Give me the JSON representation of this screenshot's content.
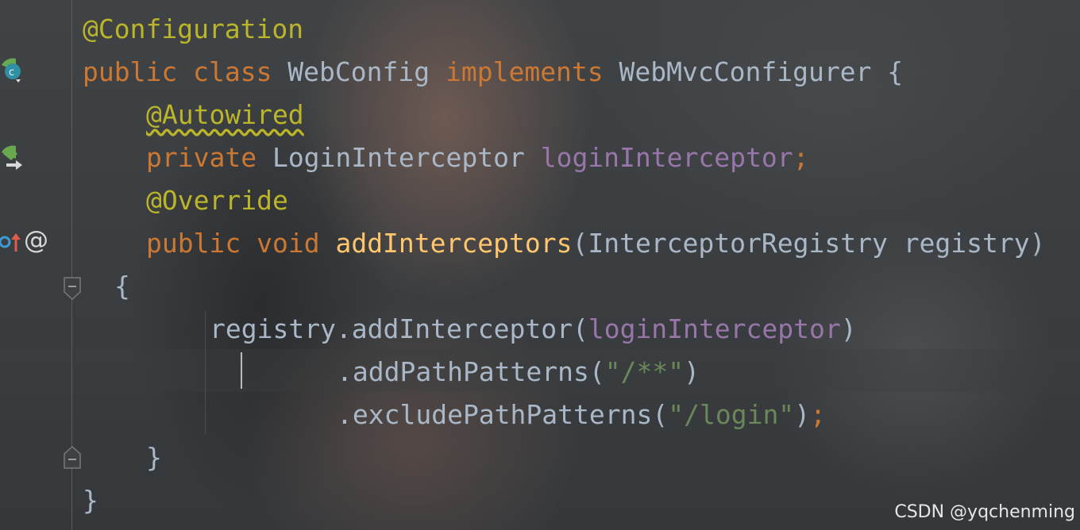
{
  "editor": {
    "lines": [
      {
        "tokens": [
          {
            "text": "@Configuration",
            "type": "ann"
          }
        ]
      },
      {
        "tokens": [
          {
            "text": "public",
            "type": "kw"
          },
          {
            "text": " ",
            "type": "plain"
          },
          {
            "text": "class",
            "type": "kw"
          },
          {
            "text": " WebConfig ",
            "type": "plain"
          },
          {
            "text": "implements",
            "type": "kw"
          },
          {
            "text": " WebMvcConfigurer {",
            "type": "plain"
          }
        ]
      },
      {
        "tokens": [
          {
            "text": "@Autowired",
            "type": "ann",
            "squiggle": true
          }
        ]
      },
      {
        "tokens": [
          {
            "text": "private",
            "type": "kw"
          },
          {
            "text": " LoginInterceptor ",
            "type": "plain"
          },
          {
            "text": "loginInterceptor",
            "type": "fld"
          },
          {
            "text": ";",
            "type": "kw"
          }
        ]
      },
      {
        "tokens": [
          {
            "text": "@Override",
            "type": "ann"
          }
        ]
      },
      {
        "tokens": [
          {
            "text": "public",
            "type": "kw"
          },
          {
            "text": " ",
            "type": "plain"
          },
          {
            "text": "void",
            "type": "kw"
          },
          {
            "text": " ",
            "type": "plain"
          },
          {
            "text": "addInterceptors",
            "type": "mth"
          },
          {
            "text": "(InterceptorRegistry registry)",
            "type": "plain"
          }
        ]
      },
      {
        "tokens": [
          {
            "text": "{",
            "type": "plain"
          }
        ]
      },
      {
        "tokens": [
          {
            "text": "registry.addInterceptor(",
            "type": "plain"
          },
          {
            "text": "loginInterceptor",
            "type": "fld"
          },
          {
            "text": ")",
            "type": "plain"
          }
        ]
      },
      {
        "tokens": [
          {
            "text": ".addPathPatterns(",
            "type": "plain"
          },
          {
            "text": "\"/**\"",
            "type": "str"
          },
          {
            "text": ")",
            "type": "plain"
          }
        ]
      },
      {
        "tokens": [
          {
            "text": ".excludePathPatterns(",
            "type": "plain"
          },
          {
            "text": "\"/login\"",
            "type": "str"
          },
          {
            "text": ")",
            "type": "plain"
          },
          {
            "text": ";",
            "type": "kw"
          }
        ]
      },
      {
        "tokens": [
          {
            "text": "}",
            "type": "plain"
          }
        ]
      },
      {
        "tokens": [
          {
            "text": "}",
            "type": "plain"
          }
        ]
      }
    ]
  },
  "gutter": {
    "icons": [
      "spring-bean-class-icon",
      "spring-autowired-navigate-icon",
      "override-method-icon",
      "annotation-at-icon",
      "fold-start-icon",
      "fold-end-icon"
    ],
    "at_symbol": "@"
  },
  "colors": {
    "keyword": "#cc7832",
    "annotation": "#bbb529",
    "field": "#9876aa",
    "method": "#ffc66d",
    "string": "#6a8759",
    "plain": "#a9b7c6"
  },
  "watermark": {
    "text": "CSDN @yqchenming"
  }
}
